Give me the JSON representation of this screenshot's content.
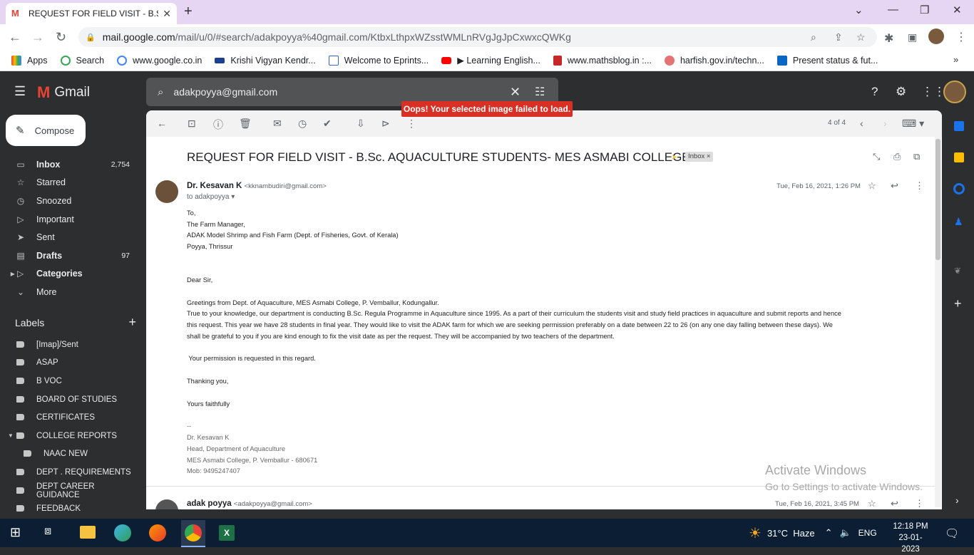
{
  "browser": {
    "tab_title": "REQUEST FOR FIELD VISIT - B.Sc.",
    "url_host": "mail.google.com",
    "url_path": "/mail/u/0/#search/adakpoyya%40gmail.com/KtbxLthpxWZsstWMLnRVgJgJpCxwxcQWKg",
    "bookmarks": [
      {
        "label": "Apps",
        "color": "#4285f4"
      },
      {
        "label": "Search",
        "color": "#34a853"
      },
      {
        "label": "www.google.co.in",
        "color": "#4285f4"
      },
      {
        "label": "Krishi Vigyan Kendr...",
        "color": "#1a3f91"
      },
      {
        "label": "Welcome to Eprints...",
        "color": "#3367d6"
      },
      {
        "label": "▶ Learning English...",
        "color": "#ff0000"
      },
      {
        "label": "www.mathsblog.in :...",
        "color": "#c62828"
      },
      {
        "label": "harfish.gov.in/techn...",
        "color": "#e57373"
      },
      {
        "label": "Present status & fut...",
        "color": "#0a66c2"
      }
    ]
  },
  "gmail": {
    "logo_text": "Gmail",
    "search_value": "adakpoyya@gmail.com",
    "error_toast": "Oops! Your selected image failed to load.",
    "compose_label": "Compose",
    "nav": [
      {
        "label": "Inbox",
        "count": "2,754",
        "icon": "inbox-icon",
        "glyph": "▭",
        "bold": true
      },
      {
        "label": "Starred",
        "count": "",
        "icon": "star-icon",
        "glyph": "☆",
        "bold": false
      },
      {
        "label": "Snoozed",
        "count": "",
        "icon": "clock-icon",
        "glyph": "◷",
        "bold": false
      },
      {
        "label": "Important",
        "count": "",
        "icon": "important-icon",
        "glyph": "▷",
        "bold": false
      },
      {
        "label": "Sent",
        "count": "",
        "icon": "send-icon",
        "glyph": "➤",
        "bold": false
      },
      {
        "label": "Drafts",
        "count": "97",
        "icon": "draft-icon",
        "glyph": "▤",
        "bold": true
      },
      {
        "label": "Categories",
        "count": "",
        "icon": "label-icon",
        "glyph": "▷",
        "bold": true
      },
      {
        "label": "More",
        "count": "",
        "icon": "chevron-down-icon",
        "glyph": "⌄",
        "bold": false
      }
    ],
    "labels_title": "Labels",
    "labels": [
      "[Imap]/Sent",
      "ASAP",
      "B VOC",
      "BOARD OF STUDIES",
      "CERTIFICATES",
      "COLLEGE REPORTS",
      "NAAC NEW",
      "DEPT . REQUIREMENTS",
      "DEPT CAREER GUIDANCE",
      "FEEDBACK"
    ],
    "pager": "4 of 4",
    "subject": "REQUEST FOR FIELD VISIT - B.Sc. AQUACULTURE STUDENTS- MES ASMABI COLLEGE",
    "inbox_badge": "Inbox ×",
    "messages": [
      {
        "sender_name": "Dr. Kesavan K",
        "sender_email": "<kknambudiri@gmail.com>",
        "to": "to adakpoyya",
        "date": "Tue, Feb 16, 2021, 1:26 PM"
      },
      {
        "sender_name": "adak poyya",
        "sender_email": "<adakpoyya@gmail.com>",
        "date": "Tue, Feb 16, 2021, 3:45 PM"
      }
    ],
    "body": {
      "to1": "To,",
      "to2": "The Farm Manager,",
      "to3": "ADAK Model Shrimp and Fish Farm (Dept. of Fisheries, Govt. of Kerala)",
      "to4": "Poyya, Thrissur",
      "greet": "Dear Sir,",
      "p1": "Greetings from Dept. of Aquaculture, MES Asmabi College, P. Vemballur, Kodungallur.",
      "p2a": "True to your knowledge, our department is conducting B.Sc. Regula Programme in Aquaculture since 1995. As a part of their curriculum the students visit and study field practices in aquaculture and submit reports and hence",
      "p2b": "this request. This year we have 28 students in final year. They would like to visit the ADAK farm for which we are seeking permission preferably on a date between 22 to 26 (on any one day falling between these days). We",
      "p2c": "shall be grateful to you if you are kind enough to fix the visit date as per the request. They will be accompanied by two teachers of the department.",
      "p3": " Your permission is requested in this regard.",
      "thanks": "Thanking you,",
      "yours": "Yours faithfully",
      "dash": "--",
      "sig1": "Dr. Kesavan K",
      "sig2": "Head, Department of Aquaculture",
      "sig3": "MES Asmabi College, P. Vemballur - 680671",
      "sig4": "Mob: 9495247407"
    },
    "activate_title": "Activate Windows",
    "activate_sub": "Go to Settings to activate Windows."
  },
  "taskbar": {
    "weather": "31°C  Haze",
    "lang": "ENG",
    "time": "12:18 PM",
    "date": "23-01-2023"
  }
}
